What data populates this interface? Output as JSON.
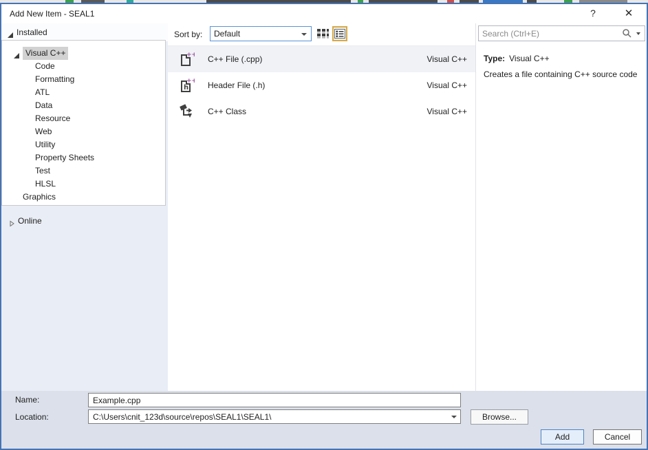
{
  "window": {
    "title": "Add New Item - SEAL1",
    "help_glyph": "?",
    "close_glyph": "✕"
  },
  "sidebar": {
    "items": [
      {
        "label": "Installed",
        "depth": 0,
        "state": "expanded"
      },
      {
        "label": "Visual C++",
        "depth": 1,
        "state": "expanded",
        "selected": true
      },
      {
        "label": "Code",
        "depth": 2
      },
      {
        "label": "Formatting",
        "depth": 2
      },
      {
        "label": "ATL",
        "depth": 2
      },
      {
        "label": "Data",
        "depth": 2
      },
      {
        "label": "Resource",
        "depth": 2
      },
      {
        "label": "Web",
        "depth": 2
      },
      {
        "label": "Utility",
        "depth": 2
      },
      {
        "label": "Property Sheets",
        "depth": 2
      },
      {
        "label": "Test",
        "depth": 2
      },
      {
        "label": "HLSL",
        "depth": 2
      },
      {
        "label": "Graphics",
        "depth": 1
      },
      {
        "label": "Online",
        "depth": 0,
        "state": "collapsed"
      }
    ]
  },
  "toolbar": {
    "sort_label": "Sort by:",
    "sort_value": "Default",
    "view_small_icon": "small-icons-view",
    "view_list_icon": "list-view"
  },
  "search": {
    "placeholder": "Search (Ctrl+E)"
  },
  "templates": {
    "items": [
      {
        "name": "C++ File (.cpp)",
        "category": "Visual C++",
        "icon": "cpp-file-icon",
        "selected": true
      },
      {
        "name": "Header File (.h)",
        "category": "Visual C++",
        "icon": "header-file-icon",
        "selected": false
      },
      {
        "name": "C++ Class",
        "category": "Visual C++",
        "icon": "cpp-class-icon",
        "selected": false
      }
    ]
  },
  "details": {
    "type_label": "Type:",
    "type_value": "Visual C++",
    "description": "Creates a file containing C++ source code"
  },
  "footer": {
    "name_label": "Name:",
    "name_value": "Example.cpp",
    "location_label": "Location:",
    "location_value": "C:\\Users\\cnit_123d\\source\\repos\\SEAL1\\SEAL1\\",
    "browse_label": "Browse...",
    "add_label": "Add",
    "cancel_label": "Cancel"
  },
  "colors": {
    "window_border": "#4673b4",
    "footer_bg": "#dbe0ea",
    "sidebar_bg": "#e9edf5",
    "selected_category_bg": "#d2d2d2",
    "selected_view_border": "#d5a94f",
    "combo_focus_border": "#5b93d6",
    "template_purple": "#9a4f9e",
    "icon_dark": "#3f3f3f",
    "add_button_border": "#4d83c2"
  }
}
